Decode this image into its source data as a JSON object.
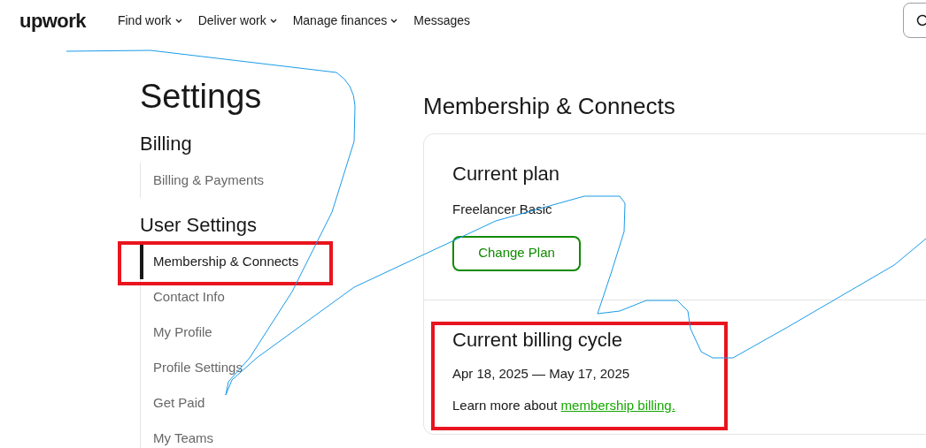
{
  "header": {
    "logo": "upwork",
    "nav": [
      {
        "label": "Find work",
        "has_menu": true
      },
      {
        "label": "Deliver work",
        "has_menu": true
      },
      {
        "label": "Manage finances",
        "has_menu": true
      },
      {
        "label": "Messages",
        "has_menu": false
      }
    ]
  },
  "sidebar": {
    "title": "Settings",
    "sections": [
      {
        "heading": "Billing",
        "items": [
          {
            "label": "Billing & Payments",
            "selected": false
          }
        ]
      },
      {
        "heading": "User Settings",
        "items": [
          {
            "label": "Membership & Connects",
            "selected": true
          },
          {
            "label": "Contact Info",
            "selected": false
          },
          {
            "label": "My Profile",
            "selected": false
          },
          {
            "label": "Profile Settings",
            "selected": false
          },
          {
            "label": "Get Paid",
            "selected": false
          },
          {
            "label": "My Teams",
            "selected": false
          }
        ]
      }
    ]
  },
  "main": {
    "title": "Membership & Connects",
    "plan": {
      "heading": "Current plan",
      "name": "Freelancer Basic",
      "button": "Change Plan"
    },
    "billing": {
      "heading": "Current billing cycle",
      "dates": "Apr 18, 2025 — May 17, 2025",
      "learn_more": "Learn more about",
      "link": "membership billing."
    }
  }
}
